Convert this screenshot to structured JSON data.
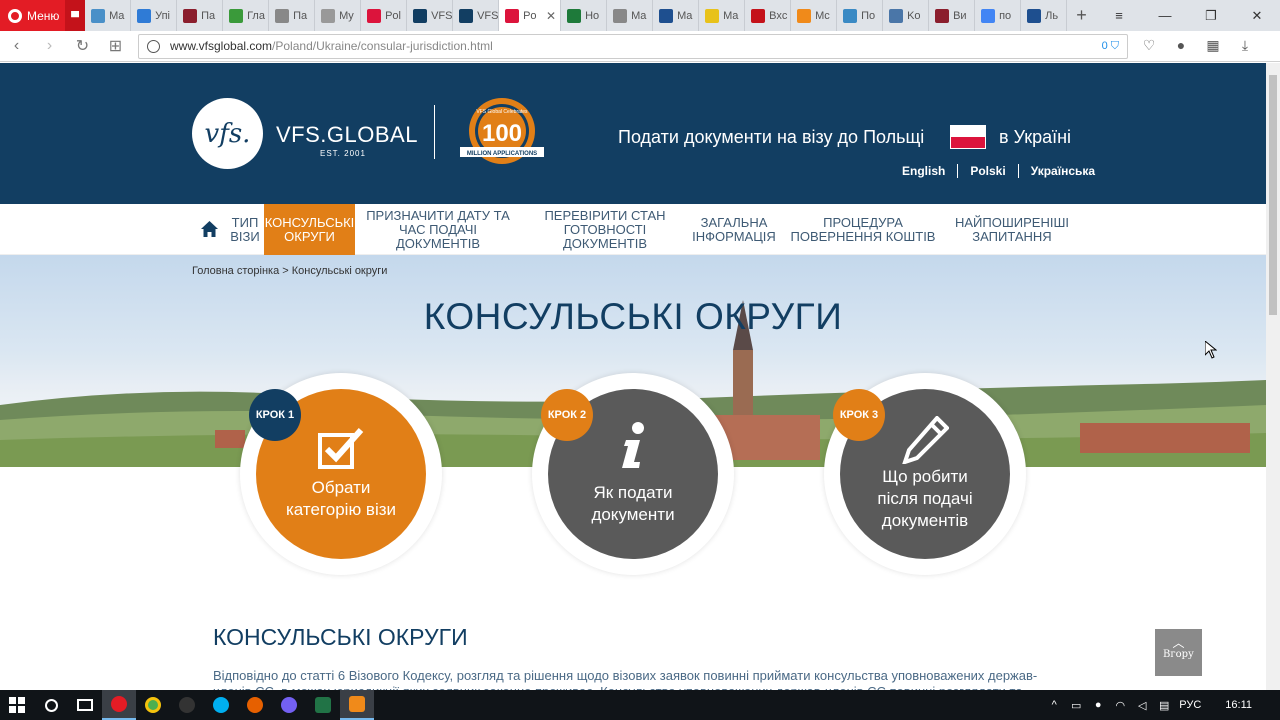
{
  "browser": {
    "menu_label": "Меню",
    "tabs": [
      {
        "label": "Ma",
        "color": "#4a90c8"
      },
      {
        "label": "Упі",
        "color": "#2f7bd6"
      },
      {
        "label": "Па",
        "color": "#8b1e2d"
      },
      {
        "label": "Гла",
        "color": "#3a9a3a"
      },
      {
        "label": "Па",
        "color": "#888888"
      },
      {
        "label": "My",
        "color": "#999999"
      },
      {
        "label": "Pol",
        "color": "#dc143c"
      },
      {
        "label": "VFS",
        "color": "#123e62"
      },
      {
        "label": "VFS",
        "color": "#123e62"
      },
      {
        "label": "Po",
        "color": "#dc143c",
        "active": true
      },
      {
        "label": "Ho",
        "color": "#1e7a3a"
      },
      {
        "label": "Ma",
        "color": "#888888"
      },
      {
        "label": "Ma",
        "color": "#1e4f8f"
      },
      {
        "label": "Ma",
        "color": "#e8c21a"
      },
      {
        "label": "Bxc",
        "color": "#c4121a"
      },
      {
        "label": "Mc",
        "color": "#f08a1a"
      },
      {
        "label": "По",
        "color": "#3a8ac4"
      },
      {
        "label": "Ko",
        "color": "#4a76a8"
      },
      {
        "label": "Ви",
        "color": "#8b1e2d"
      },
      {
        "label": "по",
        "color": "#4285f4"
      },
      {
        "label": "Ль",
        "color": "#1e4f8f"
      }
    ],
    "url_domain": "www.vfsglobal.com",
    "url_path": "/Poland/Ukraine/consular-jurisdiction.html",
    "adblock_count": "0"
  },
  "header": {
    "logo_mark": "vfs.",
    "logo_word": "VFS.GLOBAL",
    "logo_est": "EST. 2001",
    "badge_top": "VFS Global Celebrates",
    "badge_number": "100",
    "badge_bottom": "MILLION APPLICATIONS",
    "title": "Подати документи на візу до Польщі",
    "country": "в Україні",
    "languages": [
      "English",
      "Polski",
      "Українська"
    ]
  },
  "menu": {
    "items": [
      {
        "label": "ТИП ВІЗИ"
      },
      {
        "label": "КОНСУЛЬСЬКІ ОКРУГИ",
        "active": true
      },
      {
        "label": "ПРИЗНАЧИТИ ДАТУ ТА ЧАС ПОДАЧІ ДОКУМЕНТІВ"
      },
      {
        "label": "ПЕРЕВІРИТИ СТАН ГОТОВНОСТІ ДОКУМЕНТІВ"
      },
      {
        "label": "ЗАГАЛЬНА ІНФОРМАЦІЯ"
      },
      {
        "label": "ПРОЦЕДУРА ПОВЕРНЕННЯ КОШТІВ"
      },
      {
        "label": "НАЙПОШИРЕНІШІ ЗАПИТАННЯ"
      }
    ]
  },
  "breadcrumb": {
    "home": "Головна сторінка",
    "separator": ">",
    "current": "Консульські округи"
  },
  "hero": {
    "title": "КОНСУЛЬСЬКІ ОКРУГИ"
  },
  "steps": [
    {
      "badge": "КРОК 1",
      "text": "Обрати категорію візи",
      "color": "#e17f17",
      "badge_color": "#123e62",
      "icon": "checkbox-icon"
    },
    {
      "badge": "КРОК 2",
      "text": "Як подати документи",
      "color": "#5a5a5a",
      "badge_color": "#e17f17",
      "icon": "info-icon"
    },
    {
      "badge": "КРОК 3",
      "text": "Що робити після подачі документів",
      "color": "#5a5a5a",
      "badge_color": "#e17f17",
      "icon": "pencil-icon"
    }
  ],
  "content": {
    "heading": "КОНСУЛЬСЬКІ ОКРУГИ",
    "paragraph": "Відповідно до статті 6 Візового Кодексу, розгляд та рішення щодо візових заявок повинні приймати консульства уповноважених держав-членів ЄС, в межах юрисдикції яких заявник законно проживає. Консульства уповноважених держав-членів ЄС повинні розглядати та"
  },
  "to_top": {
    "label": "Вгору"
  },
  "taskbar": {
    "lang": "РУС",
    "time": "16:11"
  }
}
